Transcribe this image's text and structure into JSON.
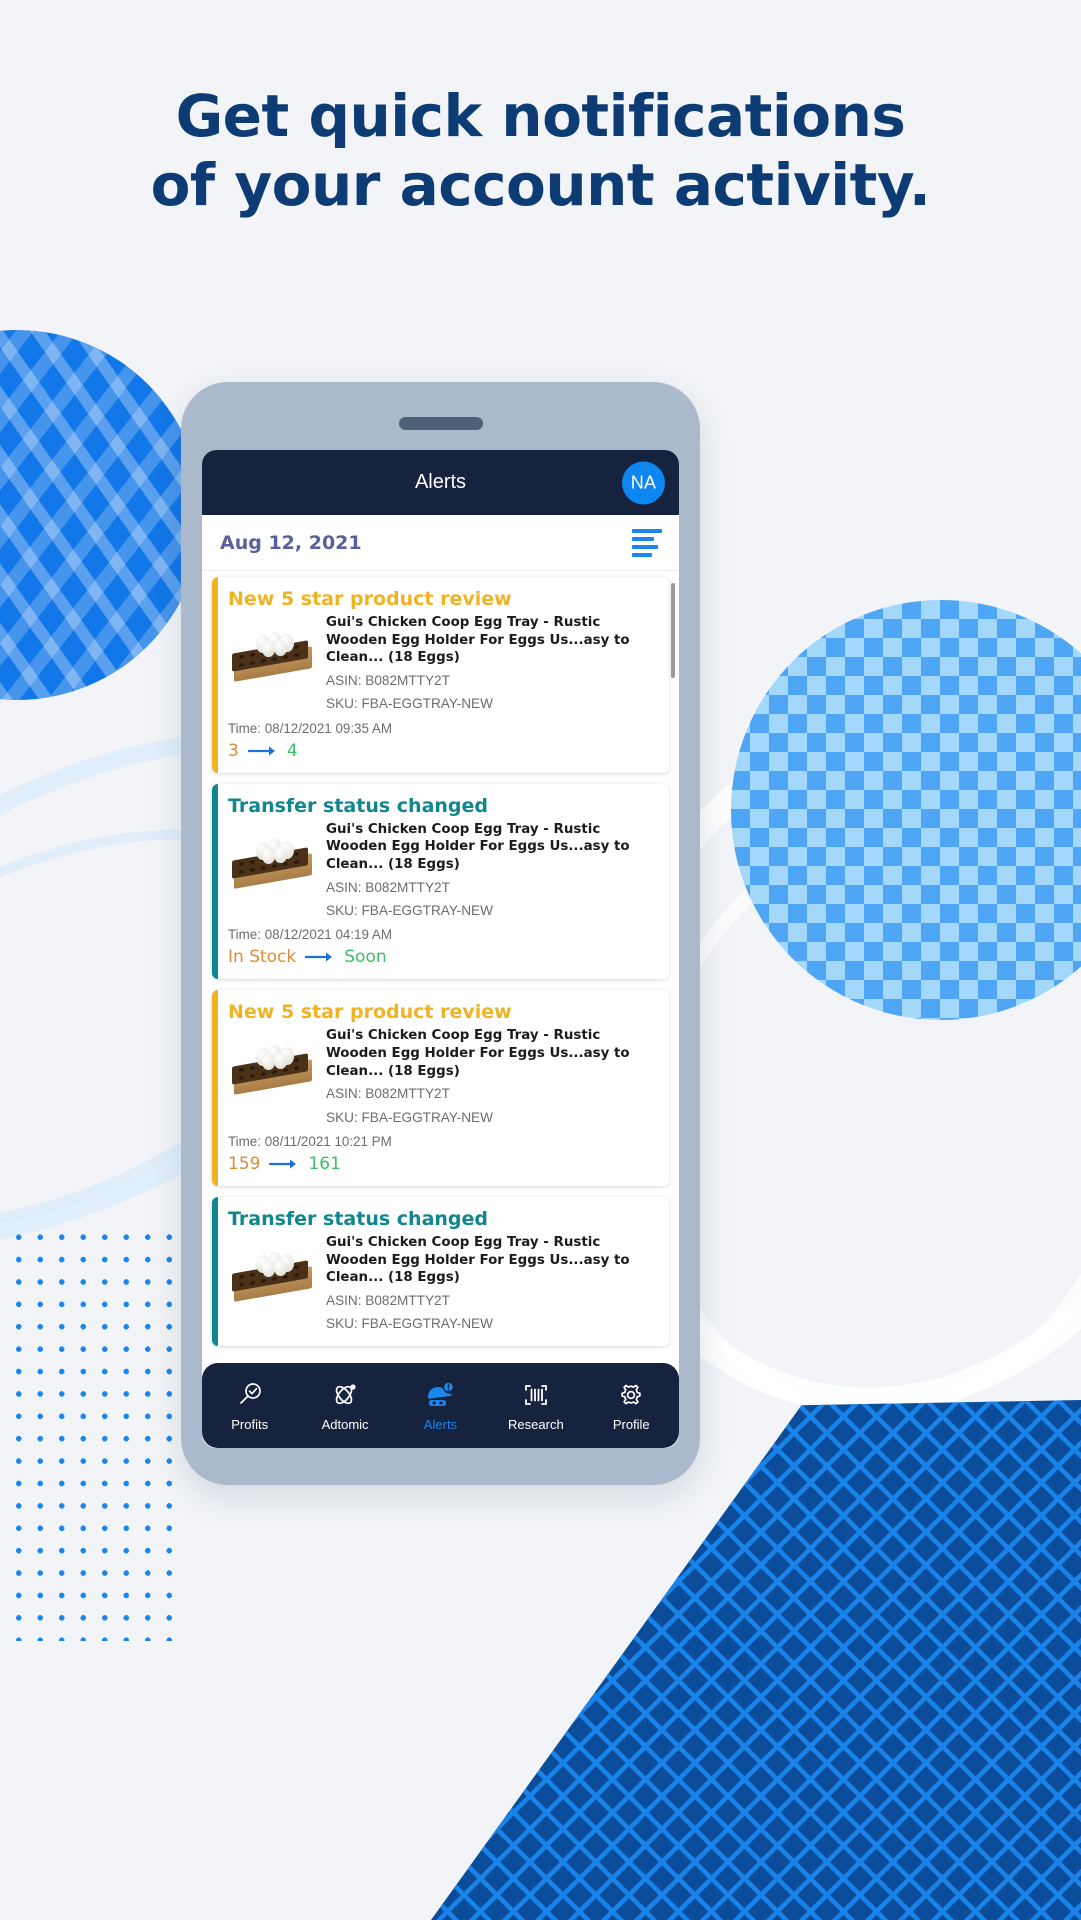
{
  "headline": {
    "line1": "Get quick notifications",
    "line2": "of your account activity."
  },
  "colors": {
    "page_background": "#f2f4f7",
    "headline_navy": "#0d3c75",
    "phone_body": "#aab9cb",
    "app_bar_navy": "#16233f",
    "accent_blue": "#1a86ee",
    "avatar_blue": "#0d86f0",
    "date_purple": "#5b5f9b",
    "review_yellow": "#f0b323",
    "transfer_teal": "#11868f",
    "value_from_orange": "#e08a33",
    "value_to_green": "#3bbf62",
    "deco_dark_blue": "#0b4d9b",
    "deco_light_blue": "#a3d8fb"
  },
  "app": {
    "header": {
      "title": "Alerts",
      "avatar_initials": "NA"
    },
    "date_bar": {
      "date": "Aug 12, 2021",
      "filter_icon": "filter-lines-icon"
    },
    "alerts": [
      {
        "type": "review",
        "title": "New 5 star product review",
        "accent_color": "#f0b323",
        "product_name": "Gui's Chicken Coop Egg Tray - Rustic Wooden Egg Holder For Eggs Us...asy to Clean... (18 Eggs)",
        "asin": "ASIN: B082MTTY2T",
        "sku": "SKU: FBA-EGGTRAY-NEW",
        "time": "Time: 08/12/2021 09:35 AM",
        "value_from": "3",
        "value_to": "4",
        "thumbnail": "egg-tray-product-image"
      },
      {
        "type": "transfer",
        "title": "Transfer status changed",
        "accent_color": "#11868f",
        "product_name": "Gui's Chicken Coop Egg Tray - Rustic Wooden Egg Holder For Eggs Us...asy to Clean... (18 Eggs)",
        "asin": "ASIN: B082MTTY2T",
        "sku": "SKU: FBA-EGGTRAY-NEW",
        "time": "Time: 08/12/2021 04:19 AM",
        "value_from": "In Stock",
        "value_to": "Soon",
        "thumbnail": "egg-tray-product-image"
      },
      {
        "type": "review",
        "title": "New 5 star product review",
        "accent_color": "#f0b323",
        "product_name": "Gui's Chicken Coop Egg Tray - Rustic Wooden Egg Holder For Eggs Us...asy to Clean... (18 Eggs)",
        "asin": "ASIN: B082MTTY2T",
        "sku": "SKU: FBA-EGGTRAY-NEW",
        "time": "Time: 08/11/2021 10:21 PM",
        "value_from": "159",
        "value_to": "161",
        "thumbnail": "egg-tray-product-image"
      },
      {
        "type": "transfer",
        "title": "Transfer status changed",
        "accent_color": "#11868f",
        "product_name": "Gui's Chicken Coop Egg Tray - Rustic Wooden Egg Holder For Eggs Us...asy to Clean... (18 Eggs)",
        "asin": "ASIN: B082MTTY2T",
        "sku": "SKU: FBA-EGGTRAY-NEW",
        "time": "",
        "value_from": "",
        "value_to": "",
        "thumbnail": "egg-tray-product-image"
      }
    ],
    "bottom_nav": [
      {
        "label": "Profits",
        "icon": "magnifier-check-icon",
        "active": false
      },
      {
        "label": "Adtomic",
        "icon": "atom-icon",
        "active": false
      },
      {
        "label": "Alerts",
        "icon": "detective-hat-icon",
        "active": true,
        "badge": "!"
      },
      {
        "label": "Research",
        "icon": "barcode-scan-icon",
        "active": false
      },
      {
        "label": "Profile",
        "icon": "gear-icon",
        "active": false
      }
    ]
  }
}
